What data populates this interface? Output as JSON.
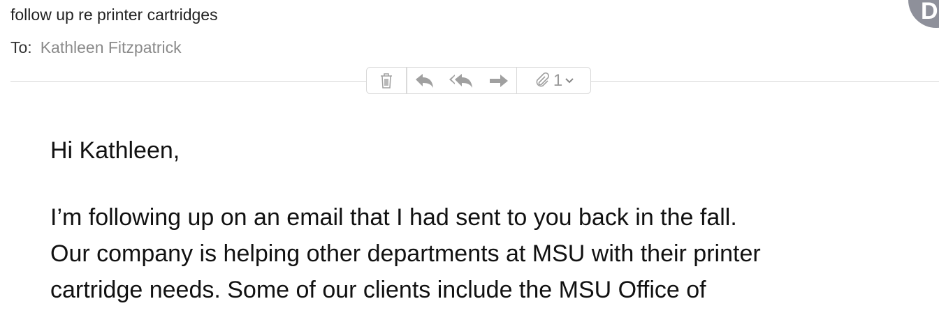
{
  "header": {
    "subject": "follow up re printer cartridges",
    "to_label": "To:",
    "to_name": "Kathleen Fitzpatrick",
    "avatar_initials": "D"
  },
  "toolbar": {
    "attachment_count": "1"
  },
  "body": {
    "greeting": "Hi Kathleen,",
    "lines": [
      "I’m following up on an email that I had sent to you back in the fall.",
      "Our company is helping other departments at MSU with their printer",
      "cartridge needs. Some of our clients include the MSU Office of"
    ]
  }
}
